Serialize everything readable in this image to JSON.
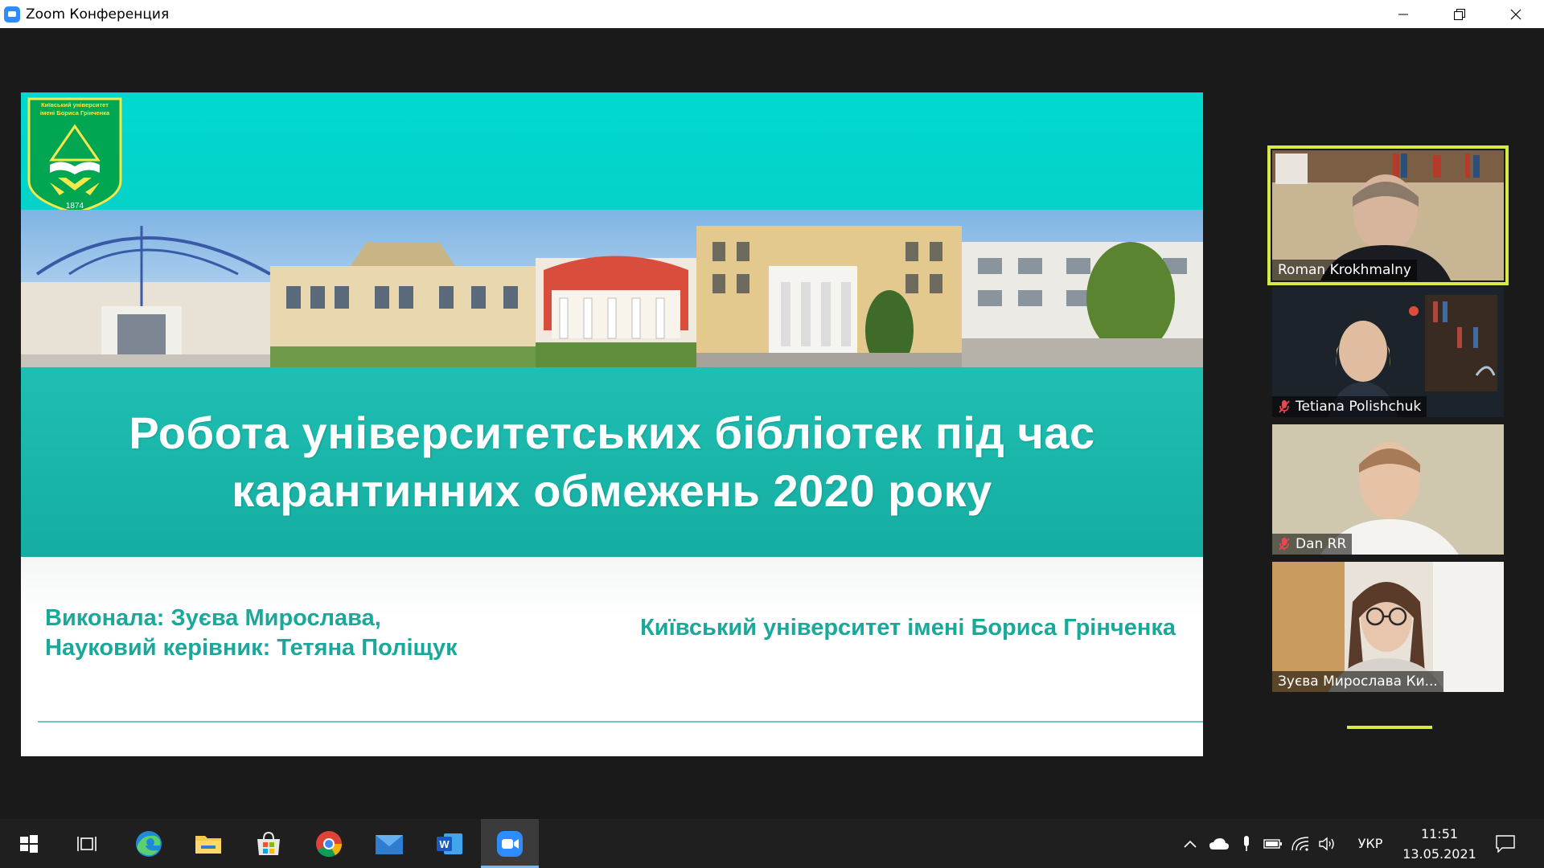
{
  "window": {
    "title": "Zoom Конференция"
  },
  "slide": {
    "logo_text": "Київський університет імені Бориса Грінченка",
    "logo_year": "1874",
    "title_line1": "Робота університетських бібліотек під час",
    "title_line2": "карантинних обмежень 2020 року",
    "author_line1": "Виконала: Зуєва Мирослава,",
    "author_line2": "Науковий керівник: Тетяна Поліщук",
    "university": "Київський університет імені Бориса Грінченка"
  },
  "participants": [
    {
      "name": "Roman Krokhmalny",
      "muted": false,
      "active_speaker": true
    },
    {
      "name": "Tetiana Polishchuk",
      "muted": true,
      "active_speaker": false
    },
    {
      "name": "Dan RR",
      "muted": true,
      "active_speaker": false
    },
    {
      "name": "Зуєва Мирослава Ки...",
      "muted": false,
      "active_speaker": false
    }
  ],
  "taskbar": {
    "apps": [
      "start-icon",
      "task-view-icon",
      "edge-icon",
      "file-explorer-icon",
      "store-icon",
      "chrome-icon",
      "mail-icon",
      "word-icon",
      "zoom-icon"
    ],
    "active_app": "zoom-icon",
    "language": "УКР",
    "time": "11:51",
    "date": "13.05.2021"
  },
  "colors": {
    "slide_teal_light": "#00d9cf",
    "slide_teal_dark": "#15ada1",
    "slide_text_green": "#1aa89a",
    "active_speaker_border": "#d6ea43",
    "zoom_blue": "#2d8cff"
  }
}
